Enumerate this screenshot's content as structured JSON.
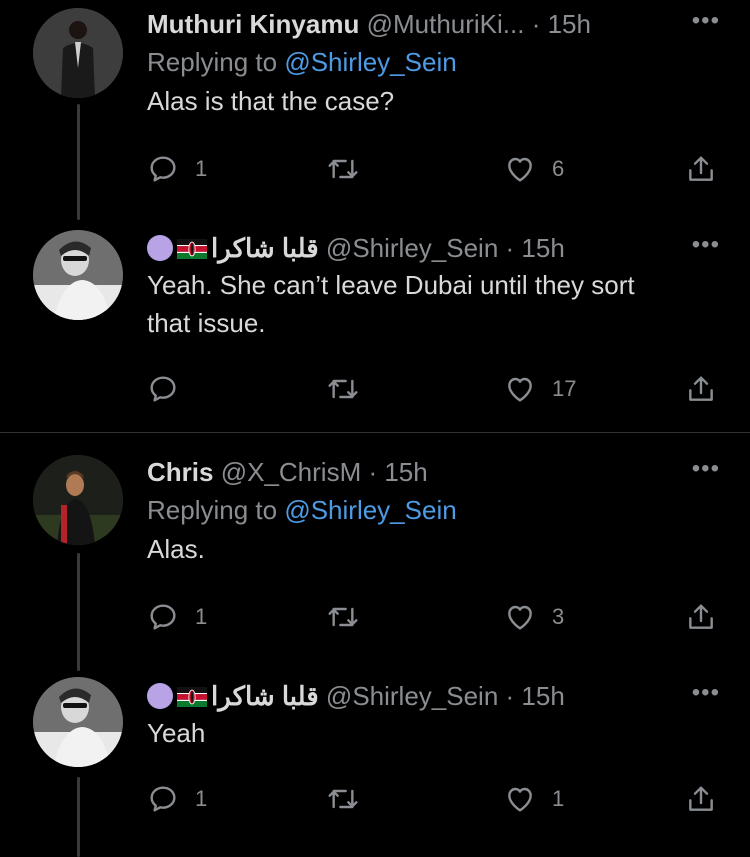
{
  "tweets": [
    {
      "name": "Muthuri Kinyamu",
      "handle": "@MuthuriKi...",
      "time": "· 15h",
      "reply_prefix": "Replying to ",
      "reply_mention": "@Shirley_Sein",
      "text": "Alas is that the case?",
      "reply_count": "1",
      "retweet_count": "",
      "like_count": "6"
    },
    {
      "name": "قلبا شاكرا",
      "handle": "@Shirley_Sein",
      "time": "· 15h",
      "text_line1": "Yeah. She can’t leave Dubai until they sort",
      "text_line2": "that issue.",
      "reply_count": "",
      "retweet_count": "",
      "like_count": "17"
    },
    {
      "name": "Chris",
      "handle": "@X_ChrisM",
      "time": "· 15h",
      "reply_prefix": "Replying to ",
      "reply_mention": "@Shirley_Sein",
      "text": "Alas.",
      "reply_count": "1",
      "retweet_count": "",
      "like_count": "3"
    },
    {
      "name": "قلبا شاكرا",
      "handle": "@Shirley_Sein",
      "time": "· 15h",
      "text": "Yeah",
      "reply_count": "1",
      "retweet_count": "",
      "like_count": "1"
    }
  ],
  "icons": {
    "more": "more-icon",
    "reply": "reply-icon",
    "retweet": "retweet-icon",
    "like": "heart-icon",
    "share": "share-icon"
  },
  "colors": {
    "background": "#000000",
    "text": "#d9d9d9",
    "muted": "#8a8d91",
    "mention": "#4e9be5"
  }
}
